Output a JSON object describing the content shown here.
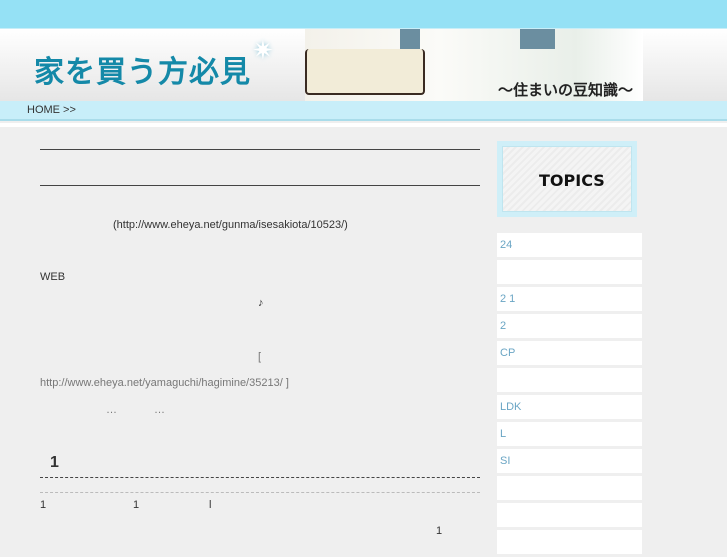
{
  "header": {
    "logo": "家を買う方必見",
    "tagline": "〜住まいの豆知識〜"
  },
  "breadcrumb": {
    "home": "HOME >>"
  },
  "main": {
    "link1": "(http://www.eheya.net/gunma/isesakiota/10523/)",
    "web": "WEB",
    "note": "♪",
    "bracket_open": "[",
    "link2": "http://www.eheya.net/yamaguchi/hagimine/35213/",
    "bracket_close": " ]",
    "ellipsis1": "…",
    "ellipsis2": "…",
    "heading": "1",
    "row": [
      "1",
      "1",
      "l"
    ],
    "footnum": "1"
  },
  "sidebar": {
    "title": "TOPICS",
    "items": [
      "24",
      "",
      "2 1",
      "2",
      "CP",
      "",
      "LDK",
      "L",
      "SI",
      "",
      "",
      ""
    ]
  }
}
